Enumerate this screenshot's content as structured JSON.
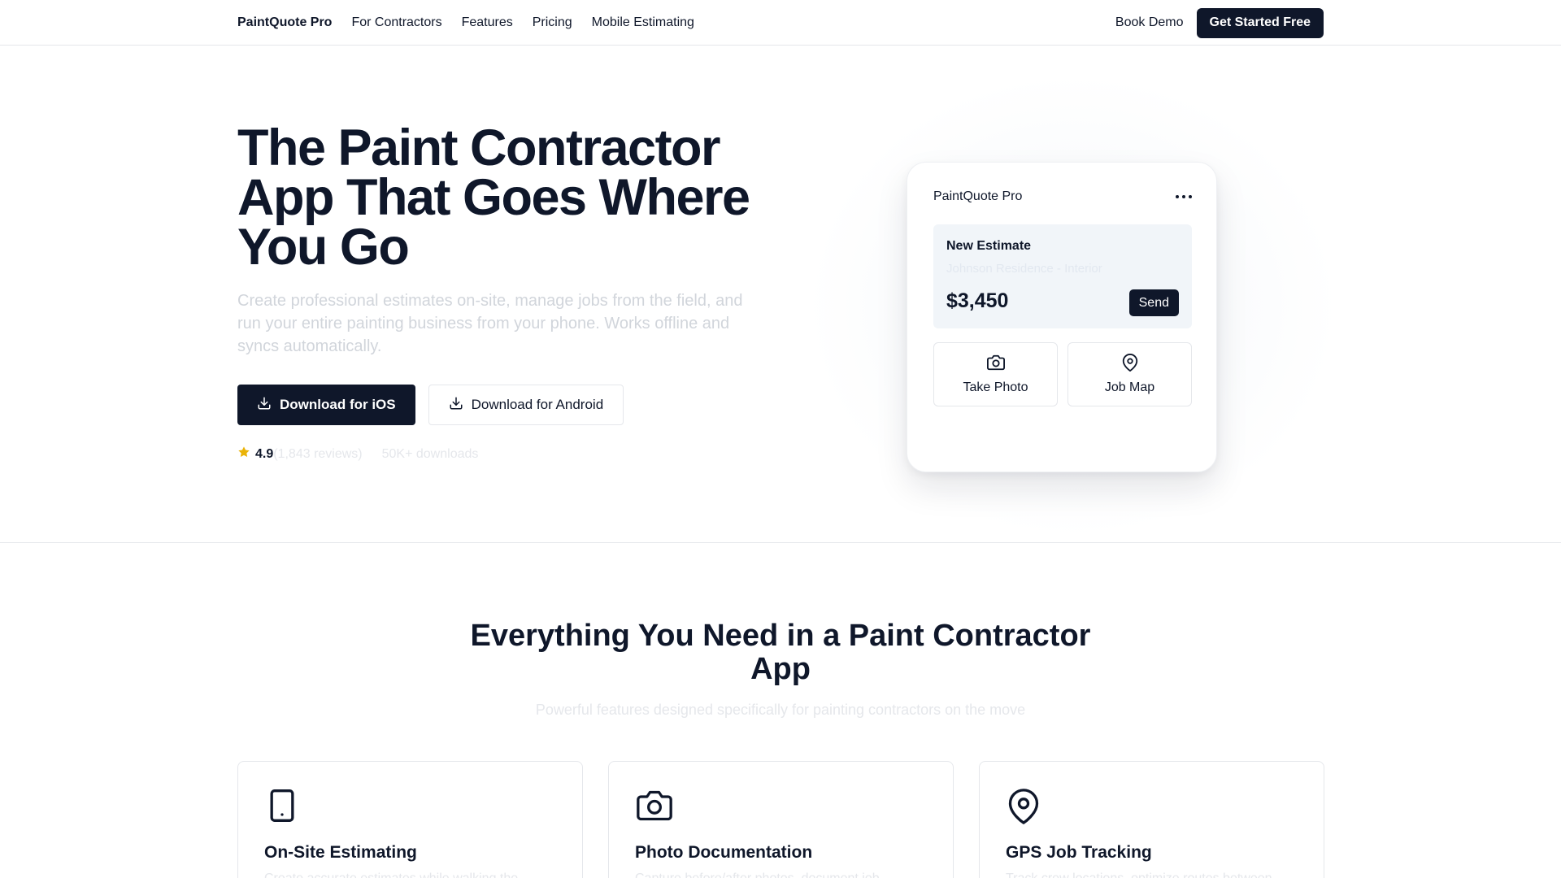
{
  "nav": {
    "brand": "PaintQuote Pro",
    "links": [
      "For Contractors",
      "Features",
      "Pricing",
      "Mobile Estimating"
    ],
    "book_demo": "Book Demo",
    "get_started": "Get Started Free"
  },
  "hero": {
    "title": "The Paint Contractor App That Goes Where You Go",
    "subtitle": "Create professional estimates on-site, manage jobs from the field, and run your entire painting business from your phone. Works offline and syncs automatically.",
    "download_ios": "Download for iOS",
    "download_android": "Download for Android",
    "rating_value": "4.9",
    "rating_reviews": "(1,843 reviews)",
    "downloads": "50K+ downloads"
  },
  "phone_card": {
    "app_name": "PaintQuote Pro",
    "estimate_title": "New Estimate",
    "estimate_job": "Johnson Residence - Interior",
    "estimate_amount": "$3,450",
    "send_label": "Send",
    "actions": [
      "Take Photo",
      "Job Map"
    ]
  },
  "features": {
    "title": "Everything You Need in a Paint Contractor App",
    "subtitle": "Powerful features designed specifically for painting contractors on the move",
    "cards": [
      {
        "icon": "smartphone-icon",
        "title": "On-Site Estimating",
        "desc": "Create accurate estimates while walking the"
      },
      {
        "icon": "camera-icon",
        "title": "Photo Documentation",
        "desc": "Capture before/after photos, document job"
      },
      {
        "icon": "map-pin-icon",
        "title": "GPS Job Tracking",
        "desc": "Track crew locations, optimize routes between"
      }
    ]
  },
  "colors": {
    "primary": "#0f172a",
    "muted_text": "#d1d5db",
    "border": "#e5e7eb",
    "star": "#eab308",
    "estimate_bg": "#f1f5f9"
  }
}
